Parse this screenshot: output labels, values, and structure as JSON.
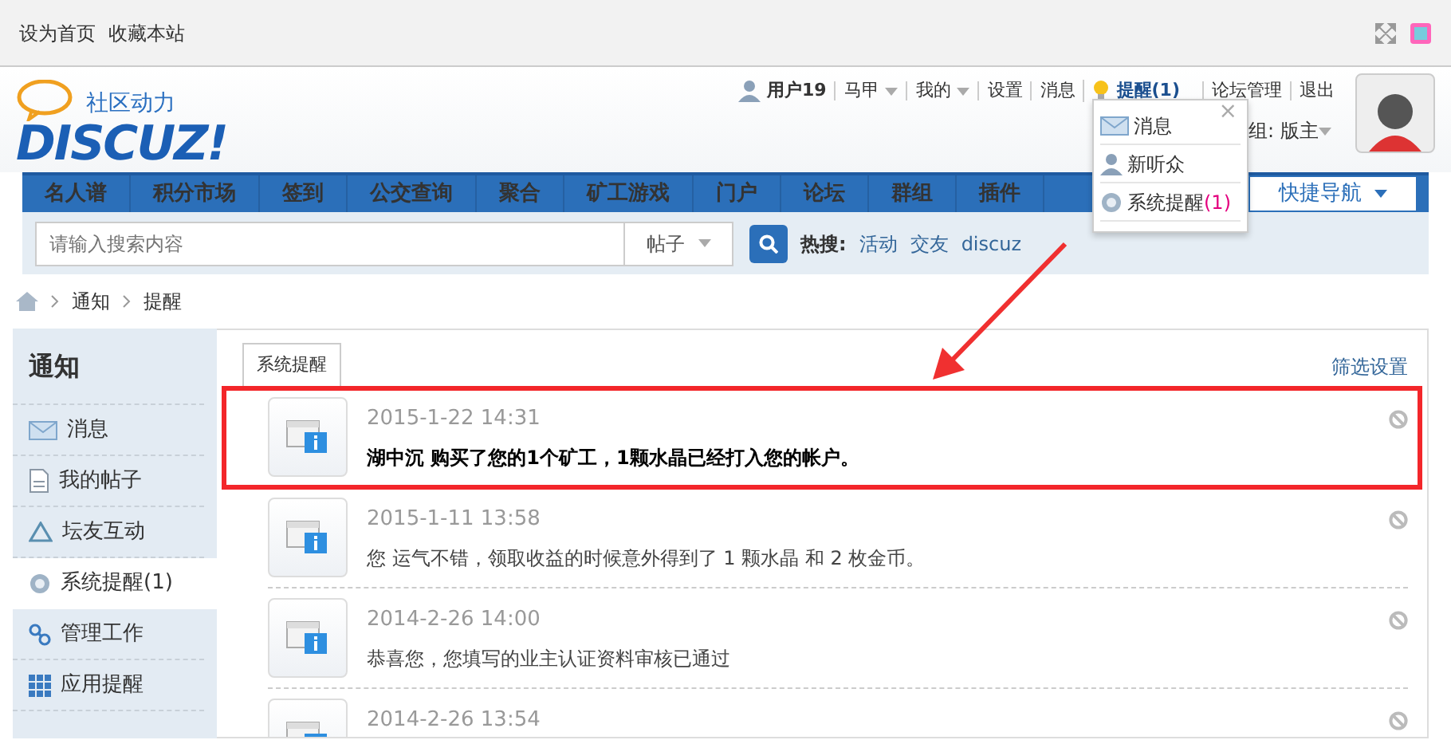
{
  "topbar": {
    "links": [
      "设为首页",
      "收藏本站"
    ]
  },
  "logo": {
    "tagline": "社区动力",
    "wordmark": "DISCUZ!"
  },
  "user_menu": [
    {
      "kind": "user",
      "label": "用户19"
    },
    {
      "kind": "dropdown",
      "label": "马甲"
    },
    {
      "kind": "dropdown",
      "label": "我的"
    },
    {
      "kind": "link",
      "label": "设置"
    },
    {
      "kind": "link",
      "label": "消息"
    },
    {
      "kind": "alert",
      "label": "提醒(1)"
    },
    {
      "kind": "link",
      "label": "论坛管理"
    },
    {
      "kind": "link",
      "label": "退出"
    }
  ],
  "user_group": "组: 版主",
  "popup": {
    "close": "×",
    "items": [
      {
        "label": "消息"
      },
      {
        "label": "新听众"
      },
      {
        "label": "系统提醒",
        "count": "(1)"
      }
    ]
  },
  "nav": {
    "items": [
      "名人谱",
      "积分市场",
      "签到",
      "公交查询",
      "聚合",
      "矿工游戏",
      "门户",
      "论坛",
      "群组",
      "插件"
    ],
    "quick_nav": "快捷导航"
  },
  "search": {
    "placeholder": "请输入搜索内容",
    "scope": "帖子",
    "hot_label": "热搜:",
    "hot": [
      "活动",
      "交友",
      "discuz"
    ]
  },
  "breadcrumb": [
    "通知",
    "提醒"
  ],
  "sidebar": {
    "title": "通知",
    "items": [
      {
        "label": "消息",
        "selected": false
      },
      {
        "label": "我的帖子",
        "selected": false
      },
      {
        "label": "坛友互动",
        "selected": false
      },
      {
        "label": "系统提醒(1)",
        "selected": true
      },
      {
        "label": "管理工作",
        "selected": false
      },
      {
        "label": "应用提醒",
        "selected": false
      }
    ]
  },
  "content": {
    "tabs": [
      {
        "label": "系统提醒",
        "selected": true
      }
    ],
    "filter": "筛选设置",
    "notices": [
      {
        "time": "2015-1-22 14:31",
        "text": "湖中沉 购买了您的1个矿工，1颗水晶已经打入您的帐户。",
        "unread": true,
        "highlighted": true
      },
      {
        "time": "2015-1-11 13:58",
        "text": "您 运气不错，领取收益的时候意外得到了 1 颗水晶 和 2 枚金币。",
        "unread": false,
        "highlighted": false
      },
      {
        "time": "2014-2-26 14:00",
        "text": "恭喜您，您填写的业主认证资料审核已通过",
        "unread": false,
        "highlighted": false
      },
      {
        "time": "2014-2-26 13:54",
        "highlighted": false
      }
    ]
  }
}
